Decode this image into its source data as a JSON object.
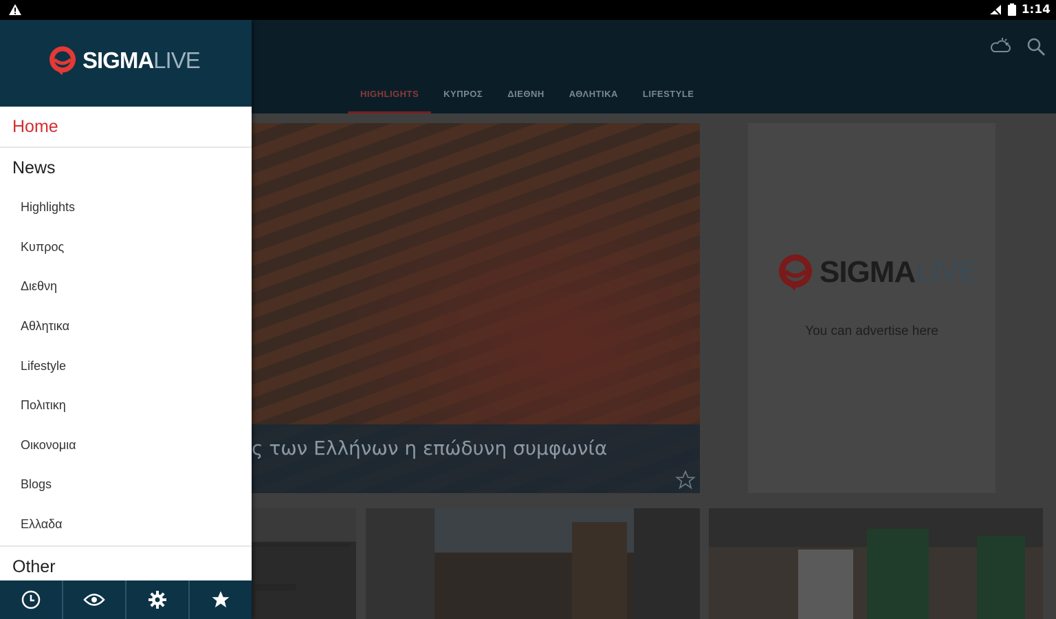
{
  "status_bar": {
    "time": "1:14"
  },
  "app": {
    "tabs": [
      {
        "label": "HIGHLIGHTS",
        "active": true
      },
      {
        "label": "ΚΥΠΡΟΣ",
        "active": false
      },
      {
        "label": "ΔΙΕΘΝΗ",
        "active": false
      },
      {
        "label": "ΑΘΛΗΤΙΚΑ",
        "active": false
      },
      {
        "label": "LIFESTYLE",
        "active": false
      }
    ],
    "hero_caption": "ς των Ελλήνων η επώδυνη συμφωνία",
    "ad": {
      "brand_main": "SIGMA",
      "brand_live": "LIVE",
      "text": "You can advertise here"
    }
  },
  "drawer": {
    "brand_main": "SIGMA",
    "brand_live": "LIVE",
    "home": "Home",
    "news_heading": "News",
    "news_items": [
      "Highlights",
      "Κυπρος",
      "Διεθνη",
      "Αθλητικα",
      "Lifestyle",
      "Πολιτικη",
      "Οικονομια",
      "Blogs",
      "Ελλαδα"
    ],
    "other_heading": "Other",
    "footer_icons": [
      "clock-icon",
      "eye-icon",
      "gear-icon",
      "star-icon"
    ]
  },
  "colors": {
    "brand_red": "#d32f2f",
    "drawer_navy": "#0d3346",
    "appbar": "#0b1e28"
  }
}
